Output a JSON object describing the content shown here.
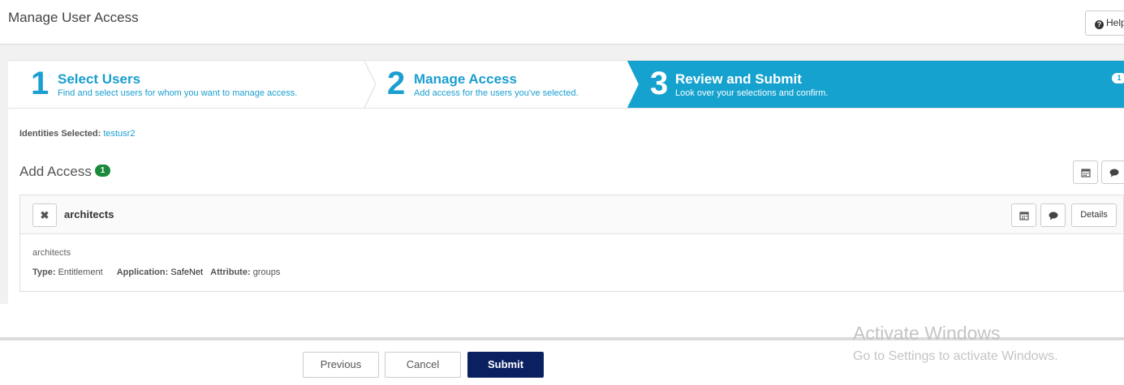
{
  "header": {
    "title": "Manage User Access",
    "help_label": "Help"
  },
  "wizard": {
    "steps": [
      {
        "number": "1",
        "title": "Select Users",
        "description": "Find and select users for whom you want to manage access."
      },
      {
        "number": "2",
        "title": "Manage Access",
        "description": "Add access for the users you've selected."
      },
      {
        "number": "3",
        "title": "Review and Submit",
        "description": "Look over your selections and confirm."
      }
    ],
    "active_step": 3,
    "step_badge": "1"
  },
  "identities": {
    "label": "Identities Selected:",
    "value": "testusr2"
  },
  "add_access": {
    "title": "Add Access",
    "count": "1"
  },
  "access_items": [
    {
      "title": "architects",
      "description": "architects",
      "details_label": "Details",
      "type_label": "Type:",
      "type_value": "Entitlement",
      "application_label": "Application:",
      "application_value": "SafeNet",
      "attribute_label": "Attribute:",
      "attribute_value": "groups"
    }
  ],
  "footer": {
    "previous_label": "Previous",
    "cancel_label": "Cancel",
    "submit_label": "Submit"
  },
  "watermark": {
    "line1": "Activate Windows",
    "line2": "Go to Settings to activate Windows."
  },
  "colors": {
    "accent": "#15a2cf",
    "submit": "#0b2061",
    "badge_green": "#1a8a3a"
  },
  "icons": [
    "help-icon",
    "calendar-icon",
    "comment-icon",
    "remove-icon"
  ]
}
